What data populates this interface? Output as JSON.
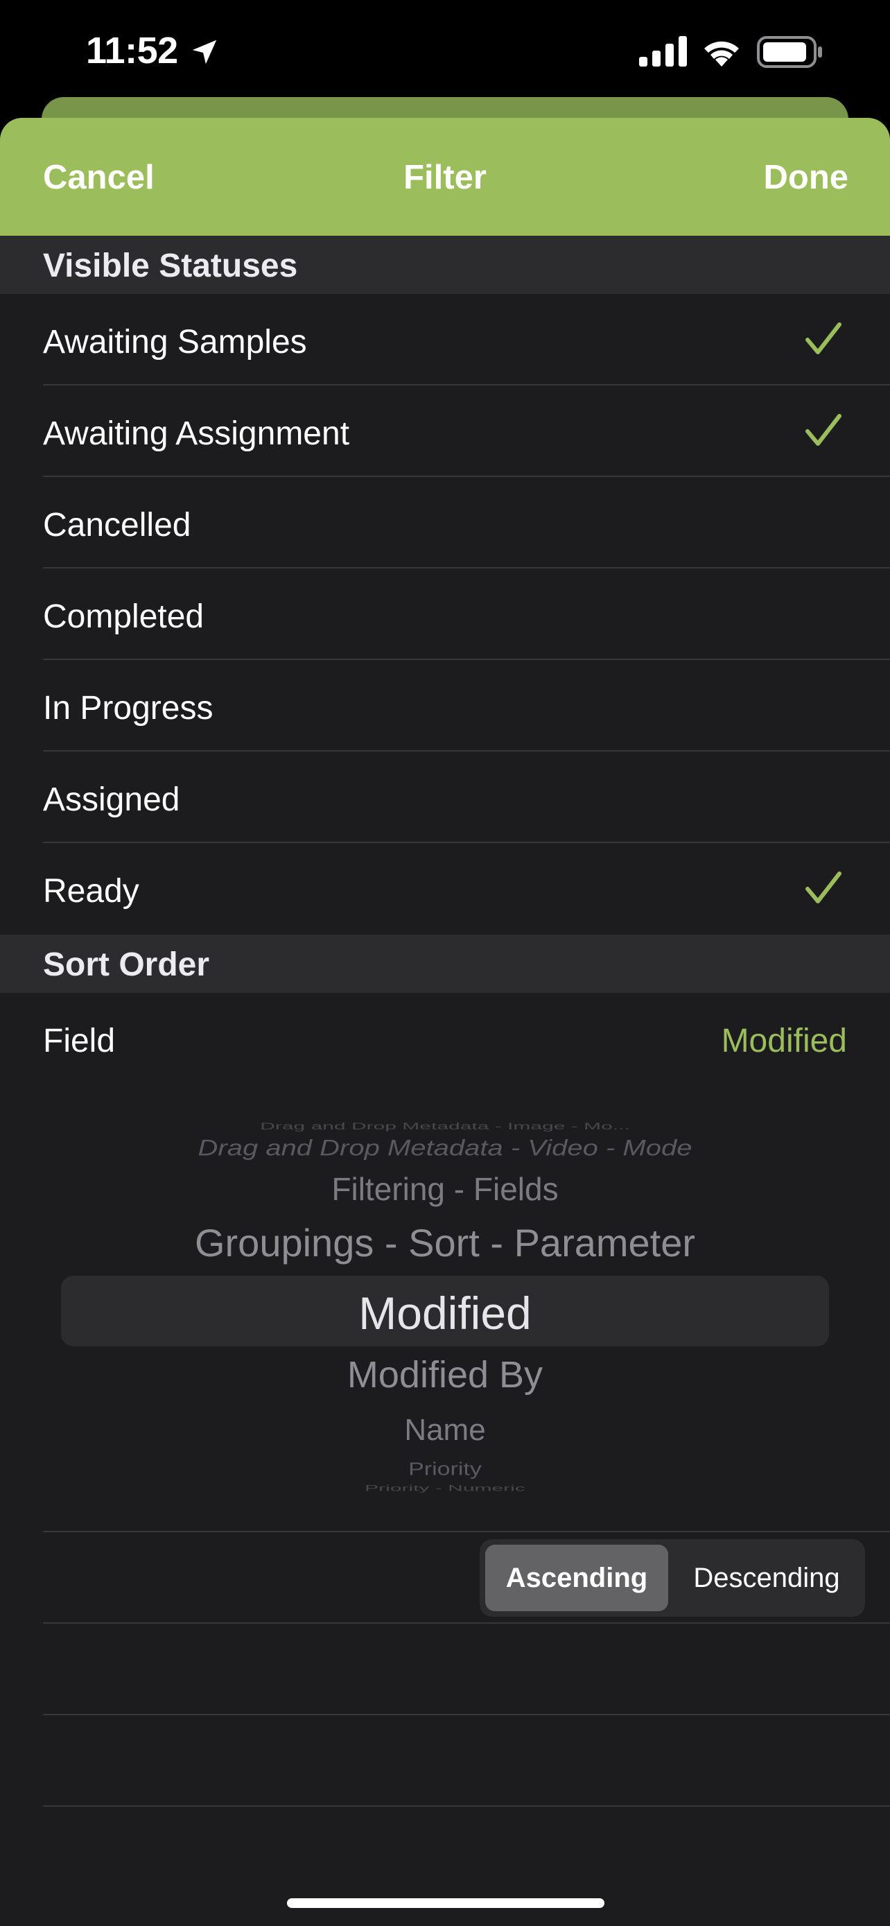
{
  "status_bar": {
    "time": "11:52"
  },
  "nav": {
    "cancel": "Cancel",
    "title": "Filter",
    "done": "Done"
  },
  "sections": {
    "visible_statuses": "Visible Statuses",
    "sort_order": "Sort Order"
  },
  "statuses": [
    {
      "label": "Awaiting Samples",
      "checked": true
    },
    {
      "label": "Awaiting Assignment",
      "checked": true
    },
    {
      "label": "Cancelled",
      "checked": false
    },
    {
      "label": "Completed",
      "checked": false
    },
    {
      "label": "In Progress",
      "checked": false
    },
    {
      "label": "Assigned",
      "checked": false
    },
    {
      "label": "Ready",
      "checked": true
    }
  ],
  "sort": {
    "field_label": "Field",
    "field_value": "Modified",
    "picker_options": [
      "Drag and Drop Metadata - Image - Mo...",
      "Drag and Drop Metadata - Video - Mode",
      "Filtering - Fields",
      "Groupings - Sort - Parameter",
      "Modified",
      "Modified By",
      "Name",
      "Priority",
      "Priority - Numeric"
    ],
    "ascending": "Ascending",
    "descending": "Descending",
    "direction": "Ascending"
  },
  "colors": {
    "accent": "#9cbd5c",
    "background": "#1c1c1e",
    "section": "#2c2c2e"
  }
}
